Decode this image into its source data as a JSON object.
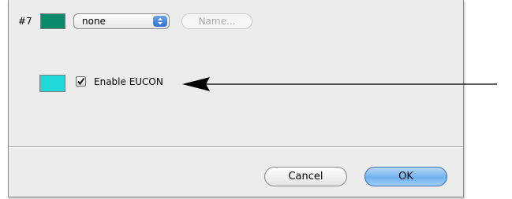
{
  "row": {
    "number": "#7",
    "swatch_color": "#0a8a6a"
  },
  "popup": {
    "value": "none"
  },
  "name_button": {
    "label": "Name..."
  },
  "eucon": {
    "swatch_color": "#20d8d8",
    "label": "Enable EUCON",
    "checked": true
  },
  "footer": {
    "cancel_label": "Cancel",
    "ok_label": "OK"
  },
  "colors": {
    "dialog_bg": "#ececec",
    "ok_accent": "#6fb0ee"
  }
}
